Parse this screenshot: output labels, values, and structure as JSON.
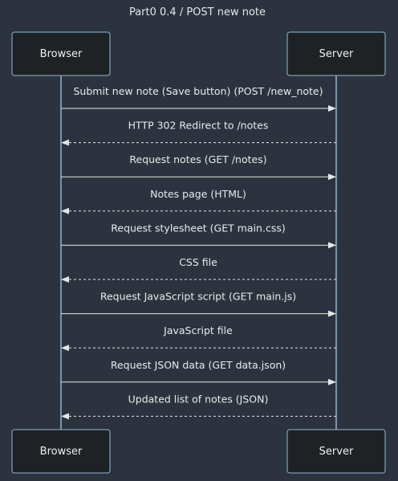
{
  "diagram": {
    "title": "Part0 0.4 / POST new note",
    "participants": [
      {
        "id": "browser",
        "label": "Browser"
      },
      {
        "id": "server",
        "label": "Server"
      }
    ],
    "messages": [
      {
        "from": "browser",
        "to": "server",
        "label": "Submit new note (Save button) (POST /new_note)",
        "style": "solid"
      },
      {
        "from": "server",
        "to": "browser",
        "label": "HTTP 302 Redirect to /notes",
        "style": "dashed"
      },
      {
        "from": "browser",
        "to": "server",
        "label": "Request notes (GET /notes)",
        "style": "solid"
      },
      {
        "from": "server",
        "to": "browser",
        "label": "Notes page (HTML)",
        "style": "dashed"
      },
      {
        "from": "browser",
        "to": "server",
        "label": "Request stylesheet (GET main.css)",
        "style": "solid"
      },
      {
        "from": "server",
        "to": "browser",
        "label": "CSS file",
        "style": "dashed"
      },
      {
        "from": "browser",
        "to": "server",
        "label": "Request JavaScript script (GET main.js)",
        "style": "solid"
      },
      {
        "from": "server",
        "to": "browser",
        "label": "JavaScript file",
        "style": "dashed"
      },
      {
        "from": "browser",
        "to": "server",
        "label": "Request JSON data (GET data.json)",
        "style": "solid"
      },
      {
        "from": "server",
        "to": "browser",
        "label": "Updated list of notes (JSON)",
        "style": "dashed"
      }
    ]
  }
}
